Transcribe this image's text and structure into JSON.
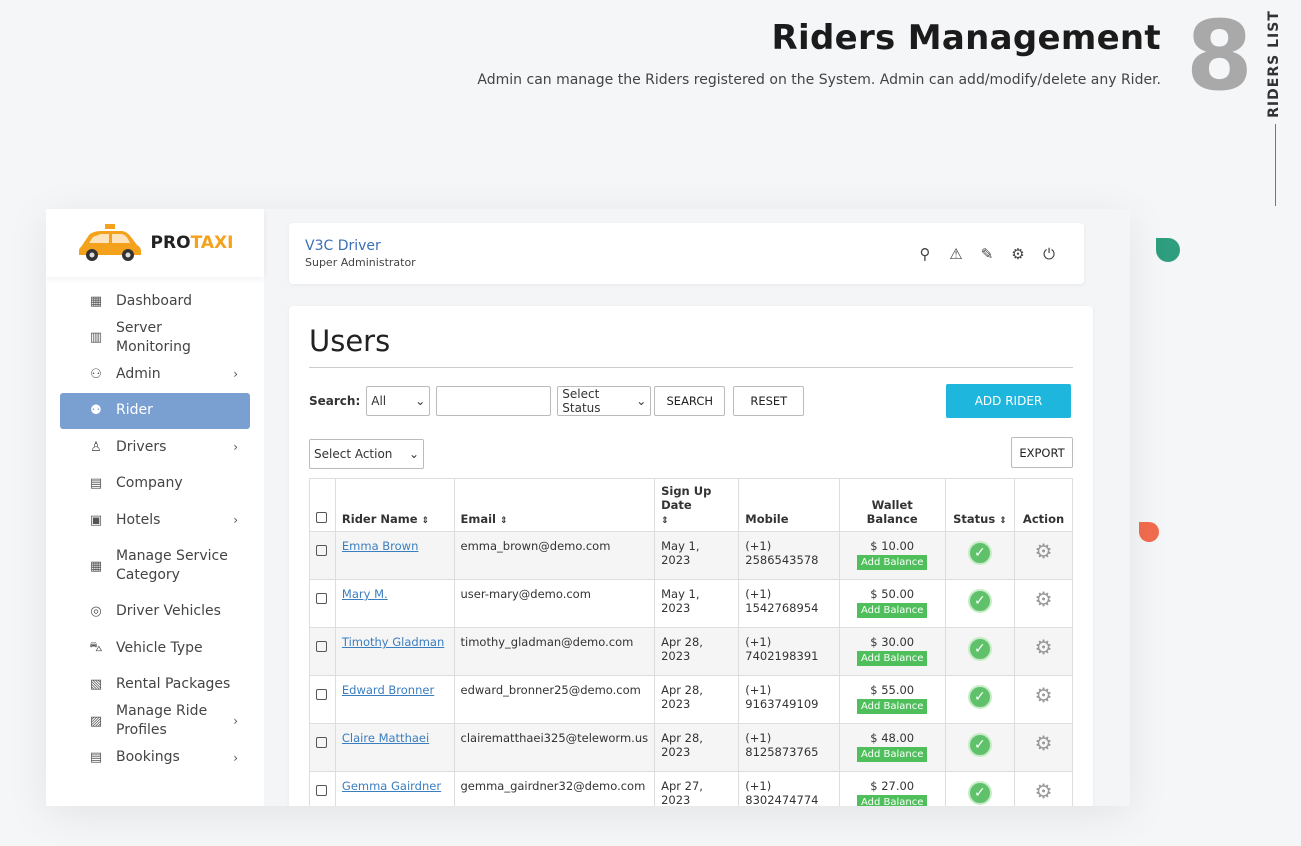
{
  "banner": {
    "title": "Riders Management",
    "subtitle": "Admin can manage the Riders registered on the System. Admin can add/modify/delete any Rider.",
    "number": "8",
    "side_tag": "RIDERS LIST"
  },
  "logo": {
    "pro": "PRO",
    "taxi": "TAXI"
  },
  "sidebar": {
    "items": [
      {
        "label": "Dashboard",
        "icon": "dashboard-icon",
        "glyph": "▦",
        "chevron": ""
      },
      {
        "label": "Server Monitoring",
        "icon": "monitor-chart-icon",
        "glyph": "▥",
        "chevron": ""
      },
      {
        "label": "Admin",
        "icon": "admin-user-icon",
        "glyph": "⚇",
        "chevron": "›"
      },
      {
        "label": "Rider",
        "icon": "rider-group-icon",
        "glyph": "⚉",
        "chevron": ""
      },
      {
        "label": "Drivers",
        "icon": "driver-icon",
        "glyph": "♙",
        "chevron": "›"
      },
      {
        "label": "Company",
        "icon": "company-building-icon",
        "glyph": "▤",
        "chevron": ""
      },
      {
        "label": "Hotels",
        "icon": "hotel-icon",
        "glyph": "▣",
        "chevron": "›"
      },
      {
        "label": "Manage Service Category",
        "icon": "service-category-icon",
        "glyph": "▦",
        "chevron": ""
      },
      {
        "label": "Driver Vehicles",
        "icon": "steering-wheel-icon",
        "glyph": "◎",
        "chevron": ""
      },
      {
        "label": "Vehicle Type",
        "icon": "vehicle-type-icon",
        "glyph": "⛍",
        "chevron": ""
      },
      {
        "label": "Rental Packages",
        "icon": "rental-package-icon",
        "glyph": "▧",
        "chevron": ""
      },
      {
        "label": "Manage Ride Profiles",
        "icon": "ride-profile-icon",
        "glyph": "▨",
        "chevron": "›"
      },
      {
        "label": "Bookings",
        "icon": "bookings-icon",
        "glyph": "▤",
        "chevron": "›"
      }
    ]
  },
  "topbar": {
    "user_name": "V3C Driver",
    "user_role": "Super Administrator"
  },
  "users": {
    "heading": "Users",
    "search_label": "Search:",
    "search_scope": "All",
    "status_select": "Select Status",
    "search_button": "SEARCH",
    "reset_button": "RESET",
    "add_button": "ADD RIDER",
    "action_select": "Select Action",
    "export_button": "EXPORT",
    "columns": {
      "name": "Rider Name",
      "email": "Email",
      "signup": "Sign Up Date",
      "mobile": "Mobile",
      "wallet": "Wallet Balance",
      "status": "Status",
      "action": "Action"
    },
    "add_balance_label": "Add Balance",
    "rows": [
      {
        "name": "Emma Brown",
        "email": "emma_brown@demo.com",
        "signup": "May 1, 2023",
        "mobile": "(+1) 2586543578",
        "balance": "$ 10.00"
      },
      {
        "name": "Mary M.",
        "email": "user-mary@demo.com",
        "signup": "May 1, 2023",
        "mobile": "(+1) 1542768954",
        "balance": "$ 50.00"
      },
      {
        "name": "Timothy Gladman",
        "email": "timothy_gladman@demo.com",
        "signup": "Apr 28, 2023",
        "mobile": "(+1) 7402198391",
        "balance": "$ 30.00"
      },
      {
        "name": "Edward Bronner",
        "email": "edward_bronner25@demo.com",
        "signup": "Apr 28, 2023",
        "mobile": "(+1) 9163749109",
        "balance": "$ 55.00"
      },
      {
        "name": "Claire Matthaei",
        "email": "clairematthaei325@teleworm.us",
        "signup": "Apr 28, 2023",
        "mobile": "(+1) 8125873765",
        "balance": "$ 48.00"
      },
      {
        "name": "Gemma Gairdner",
        "email": "gemma_gairdner32@demo.com",
        "signup": "Apr 27, 2023",
        "mobile": "(+1) 8302474774",
        "balance": "$ 27.00"
      }
    ]
  }
}
